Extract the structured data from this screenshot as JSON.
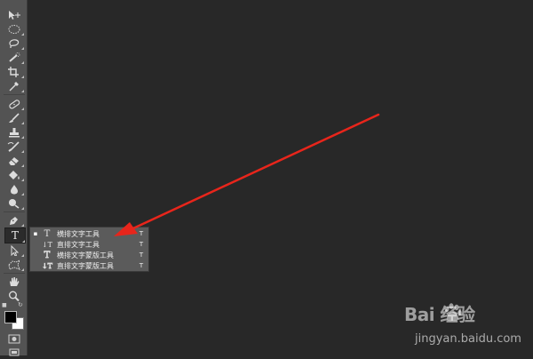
{
  "colors": {
    "canvas": "#282828",
    "toolbar": "#535353",
    "flyout": "#5b5b5b",
    "arrow": "#e8251b",
    "foreground_swatch": "#000000",
    "background_swatch": "#ffffff"
  },
  "toolbar": {
    "tools": [
      {
        "name": "move-tool",
        "icon": "move-icon"
      },
      {
        "name": "marquee-tool",
        "icon": "ellipse-marquee-icon"
      },
      {
        "name": "lasso-tool",
        "icon": "lasso-icon"
      },
      {
        "name": "quick-selection-tool",
        "icon": "quick-selection-icon"
      },
      {
        "name": "crop-tool",
        "icon": "crop-icon"
      },
      {
        "name": "eyedropper-tool",
        "icon": "eyedropper-icon"
      },
      {
        "name": "healing-brush-tool",
        "icon": "bandage-icon"
      },
      {
        "name": "brush-tool",
        "icon": "brush-icon"
      },
      {
        "name": "clone-stamp-tool",
        "icon": "stamp-icon"
      },
      {
        "name": "history-brush-tool",
        "icon": "history-brush-icon"
      },
      {
        "name": "eraser-tool",
        "icon": "eraser-icon"
      },
      {
        "name": "paint-bucket-tool",
        "icon": "paint-bucket-icon"
      },
      {
        "name": "blur-tool",
        "icon": "drop-icon"
      },
      {
        "name": "dodge-tool",
        "icon": "dodge-icon"
      },
      {
        "name": "pen-tool",
        "icon": "pen-icon"
      },
      {
        "name": "type-tool",
        "icon": "type-icon",
        "label": "T"
      },
      {
        "name": "path-selection-tool",
        "icon": "path-arrow-icon"
      },
      {
        "name": "shape-tool",
        "icon": "custom-shape-icon"
      },
      {
        "name": "hand-tool",
        "icon": "hand-icon"
      },
      {
        "name": "zoom-tool",
        "icon": "magnifier-icon"
      }
    ]
  },
  "flyout": {
    "items": [
      {
        "icon": "horizontal-type-icon",
        "glyph": "T",
        "label": "横排文字工具",
        "key": "T",
        "selected": true
      },
      {
        "icon": "vertical-type-icon",
        "glyph": "↓T",
        "label": "直排文字工具",
        "key": "T",
        "selected": false
      },
      {
        "icon": "horizontal-type-mask-icon",
        "glyph": "T",
        "label": "横排文字蒙版工具",
        "key": "T",
        "selected": false
      },
      {
        "icon": "vertical-type-mask-icon",
        "glyph": "↓T",
        "label": "直排文字蒙版工具",
        "key": "T",
        "selected": false
      }
    ],
    "selected_marker": "▪"
  },
  "watermark": {
    "logo_text": "Bai 经验",
    "url_text": "jingyan.baidu.com"
  }
}
